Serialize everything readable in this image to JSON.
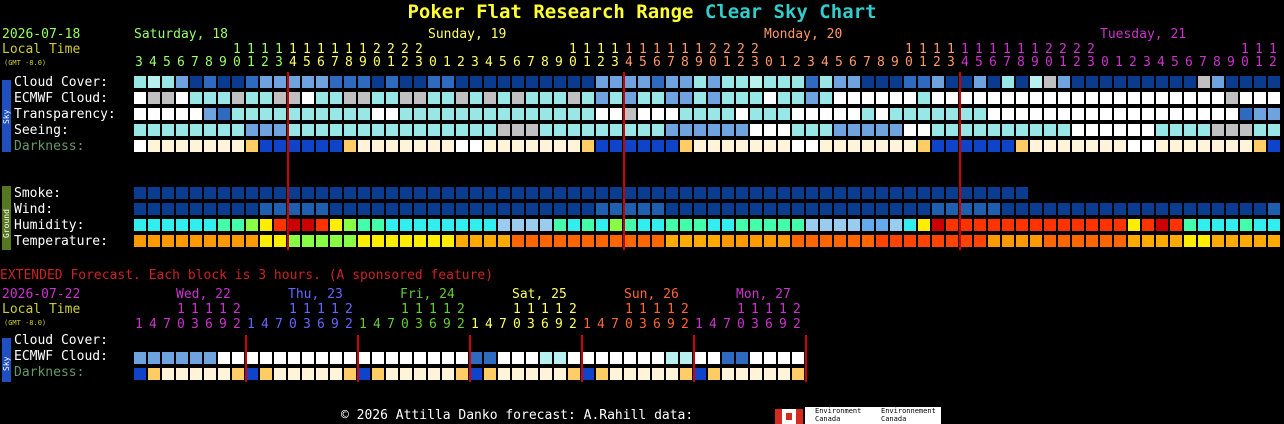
{
  "header": {
    "title_part1": "Poker Flat Research Range",
    "title_part2": "Clear Sky Chart",
    "color_title1": "#ffff33",
    "color_title2": "#33cccc"
  },
  "main": {
    "date": "2026-07-18",
    "local_time_label": "Local Time",
    "gmt_label": "(GMT -8.0)",
    "days": [
      {
        "label": "Saturday, 18",
        "color": "#99ff66"
      },
      {
        "label": "Sunday, 19",
        "color": "#ffff66"
      },
      {
        "label": "Monday, 20",
        "color": "#ff9966"
      },
      {
        "label": "Tuesday, 21",
        "color": "#cc33cc"
      }
    ],
    "hours_tens": "1111111122221111111111112222111111111111222211111111111111112222",
    "hours_ones": "34567890123012345678901230123456789012301234567890123012345678901234567890123456789012",
    "rows_sky": [
      {
        "label": "Cloud Cover:",
        "color": "#ffffff"
      },
      {
        "label": "ECMWF Cloud:",
        "color": "#ffffff"
      },
      {
        "label": "Transparency:",
        "color": "#ffffff"
      },
      {
        "label": "Seeing:",
        "color": "#ffffff"
      },
      {
        "label": "Darkness:",
        "color": "#669966"
      }
    ],
    "rows_ground": [
      {
        "label": "Smoke:",
        "color": "#ffffff"
      },
      {
        "label": "Wind:",
        "color": "#ffffff"
      },
      {
        "label": "Humidity:",
        "color": "#ffffff"
      },
      {
        "label": "Temperature:",
        "color": "#ffffff"
      }
    ],
    "sidebar_sky": "Sky",
    "sidebar_ground": "Ground"
  },
  "extended": {
    "notice": "EXTENDED Forecast. Each block is 3 hours. (A sponsored feature)",
    "notice_color": "#cc2222",
    "date": "2026-07-22",
    "local_time_label": "Local Time",
    "gmt_label": "(GMT -8.0)",
    "days": [
      {
        "label": "Wed, 22",
        "color": "#cc33cc"
      },
      {
        "label": "Thu, 23",
        "color": "#6666ff"
      },
      {
        "label": "Fri, 24",
        "color": "#66cc33"
      },
      {
        "label": "Sat, 25",
        "color": "#ffff66"
      },
      {
        "label": "Sun, 26",
        "color": "#ff6633"
      },
      {
        "label": "Mon, 27",
        "color": "#cc33cc"
      }
    ],
    "hours_tens": "11112",
    "hours_ones": "147036921470369214703692147036921470369214703692",
    "rows": [
      {
        "label": "Cloud Cover:",
        "color": "#ffffff"
      },
      {
        "label": "ECMWF Cloud:",
        "color": "#ffffff"
      },
      {
        "label": "Darkness:",
        "color": "#669966"
      }
    ],
    "sidebar_sky": "Sky"
  },
  "footer": {
    "text": "© 2026 Attilla Danko  forecast: A.Rahill  data:",
    "env_canada_1": "Environment Canada",
    "env_canada_2": "Environnement Canada"
  }
}
